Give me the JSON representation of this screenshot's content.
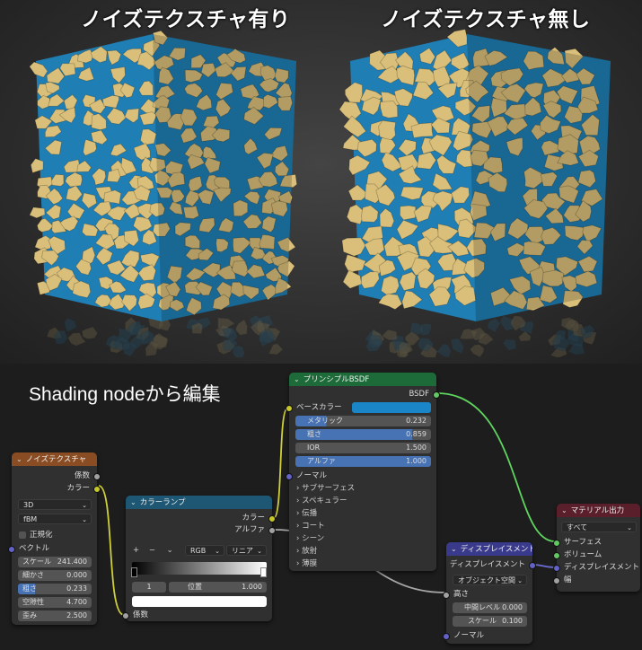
{
  "renders": {
    "left_caption": "ノイズテクスチャ有り",
    "right_caption": "ノイズテクスチャ無し",
    "colors": {
      "stone": "#d9bf7a",
      "fill": "#1f7fb5",
      "background": "#3a3a3a"
    }
  },
  "editor": {
    "title": "Shading nodeから編集",
    "colors": {
      "noise_header": "#8a4c22",
      "ramp_header": "#1d5773",
      "bsdf_header": "#1e6b3a",
      "disp_header": "#3a3a8c",
      "out_header": "#5a1f2a",
      "green_wire": "#5fd45f",
      "purple_wire": "#6b6bd4",
      "yellow_wire": "#cfcf3a",
      "gray_wire": "#a5a5a5"
    },
    "noise": {
      "header": "ノイズテクスチャ",
      "out_fac": "係数",
      "out_color": "カラー",
      "dim": "3D",
      "type": "fBM",
      "normalize": "正規化",
      "vector": "ベクトル",
      "params": [
        {
          "label": "スケール",
          "value": "241.400"
        },
        {
          "label": "細かさ",
          "value": "0.000"
        },
        {
          "label": "粗さ",
          "value": "0.233"
        },
        {
          "label": "空隙性",
          "value": "4.700"
        },
        {
          "label": "歪み",
          "value": "2.500"
        }
      ]
    },
    "ramp": {
      "header": "カラーランプ",
      "out_color": "カラー",
      "out_alpha": "アルファ",
      "plus": "+",
      "minus": "−",
      "mode": "RGB",
      "interp": "リニア",
      "index": "1",
      "pos_label": "位置",
      "pos_value": "1.000",
      "in_fac": "係数"
    },
    "bsdf": {
      "header": "プリンシプルBSDF",
      "out": "BSDF",
      "base": "ベースカラー",
      "base_color": "#1a86c8",
      "params": [
        {
          "label": "メタリック",
          "value": "0.232"
        },
        {
          "label": "粗さ",
          "value": "0.859"
        },
        {
          "label": "IOR",
          "value": "1.500"
        },
        {
          "label": "アルファ",
          "value": "1.000"
        }
      ],
      "normal": "ノーマル",
      "panels": [
        "サブサーフェス",
        "スペキュラー",
        "伝播",
        "コート",
        "シーン",
        "放射",
        "薄膜"
      ]
    },
    "disp": {
      "header": "ディスプレイスメント",
      "out": "ディスプレイスメント",
      "space": "オブジェクト空間",
      "height": "高さ",
      "params": [
        {
          "label": "中間レベル",
          "value": "0.000"
        },
        {
          "label": "スケール",
          "value": "0.100"
        }
      ],
      "normal": "ノーマル"
    },
    "output": {
      "header": "マテリアル出力",
      "target": "すべて",
      "sockets": [
        "サーフェス",
        "ボリューム",
        "ディスプレイスメント",
        "幅"
      ]
    }
  }
}
